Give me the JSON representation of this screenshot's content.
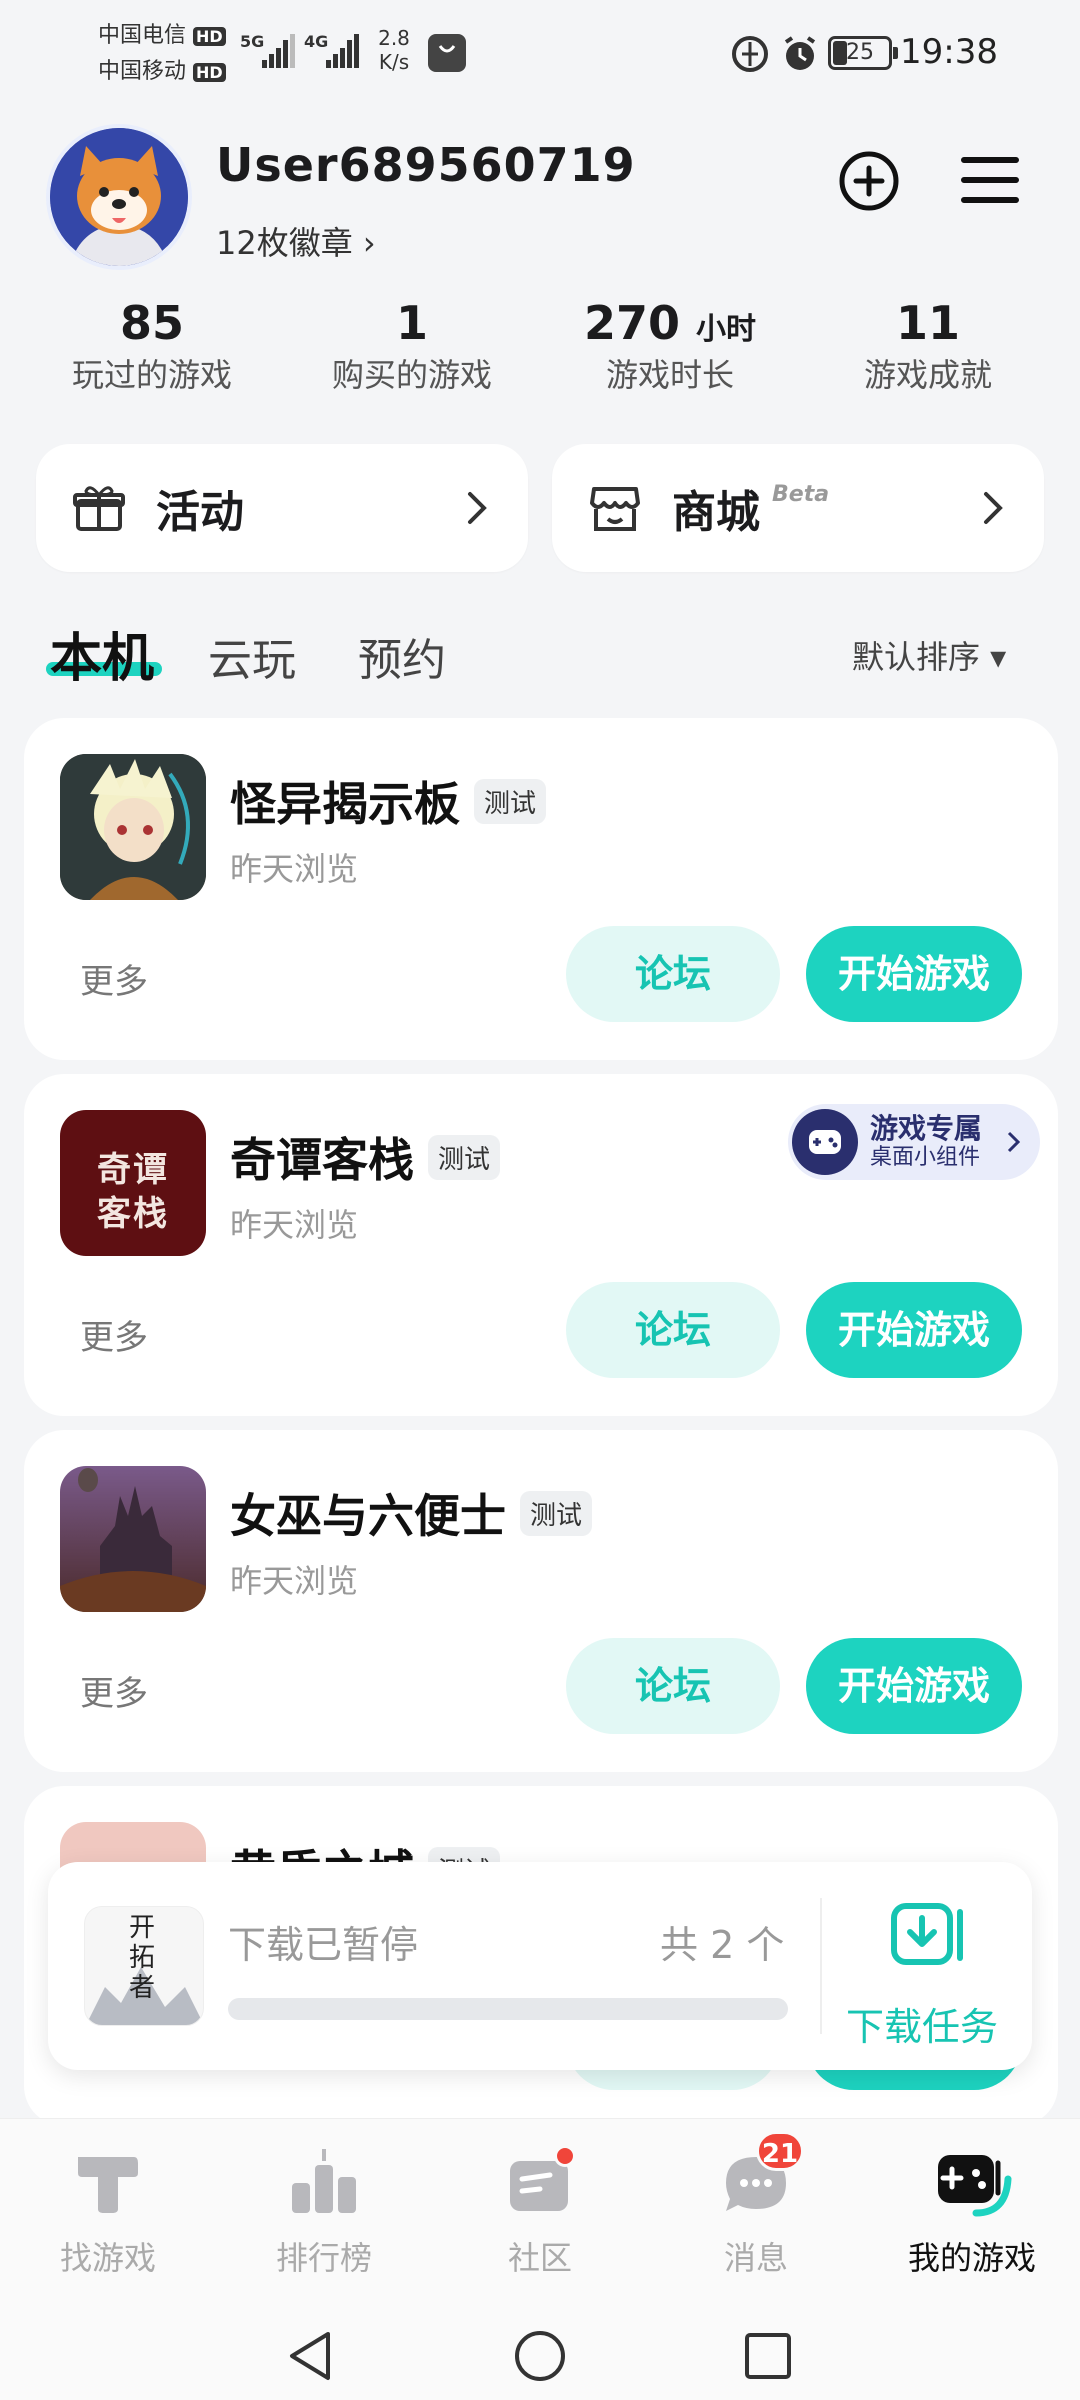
{
  "status_bar": {
    "carrier1": "中国电信",
    "carrier2": "中国移动",
    "hd": "HD",
    "net1": "5G",
    "net2": "4G",
    "speed_value": "2.8",
    "speed_unit": "K/s",
    "battery": "25",
    "time": "19:38"
  },
  "profile": {
    "username": "User689560719",
    "badges": "12枚徽章 ›"
  },
  "stats": [
    {
      "value": "85",
      "unit": "",
      "label": "玩过的游戏"
    },
    {
      "value": "1",
      "unit": "",
      "label": "购买的游戏"
    },
    {
      "value": "270",
      "unit": "小时",
      "label": "游戏时长"
    },
    {
      "value": "11",
      "unit": "",
      "label": "游戏成就"
    }
  ],
  "cards": {
    "activity": "活动",
    "shop": "商城",
    "shop_badge": "Beta"
  },
  "tabs": {
    "local": "本机",
    "cloud": "云玩",
    "reserve": "预约",
    "sort": "默认排序 ▾"
  },
  "games": [
    {
      "name": "怪异揭示板",
      "tag": "测试",
      "sub": "昨天浏览",
      "more": "更多",
      "forum": "论坛",
      "start": "开始游戏"
    },
    {
      "name": "奇谭客栈",
      "tag": "测试",
      "sub": "昨天浏览",
      "more": "更多",
      "forum": "论坛",
      "start": "开始游戏",
      "icon_text1": "奇谭",
      "icon_text2": "客栈"
    },
    {
      "name": "女巫与六便士",
      "tag": "测试",
      "sub": "昨天浏览",
      "more": "更多",
      "forum": "论坛",
      "start": "开始游戏"
    },
    {
      "name": "黄昏之城",
      "tag": "测试"
    }
  ],
  "widget": {
    "title": "游戏专属",
    "subtitle": "桌面小组件"
  },
  "download": {
    "icon_text": "开拓者",
    "status": "下载已暂停",
    "count": "共 2 个",
    "progress": 0,
    "task": "下载任务"
  },
  "nav": [
    {
      "label": "找游戏"
    },
    {
      "label": "排行榜"
    },
    {
      "label": "社区"
    },
    {
      "label": "消息",
      "badge": "21"
    },
    {
      "label": "我的游戏"
    }
  ],
  "colors": {
    "accent": "#1dd3c0",
    "badge_red": "#f0453a"
  }
}
